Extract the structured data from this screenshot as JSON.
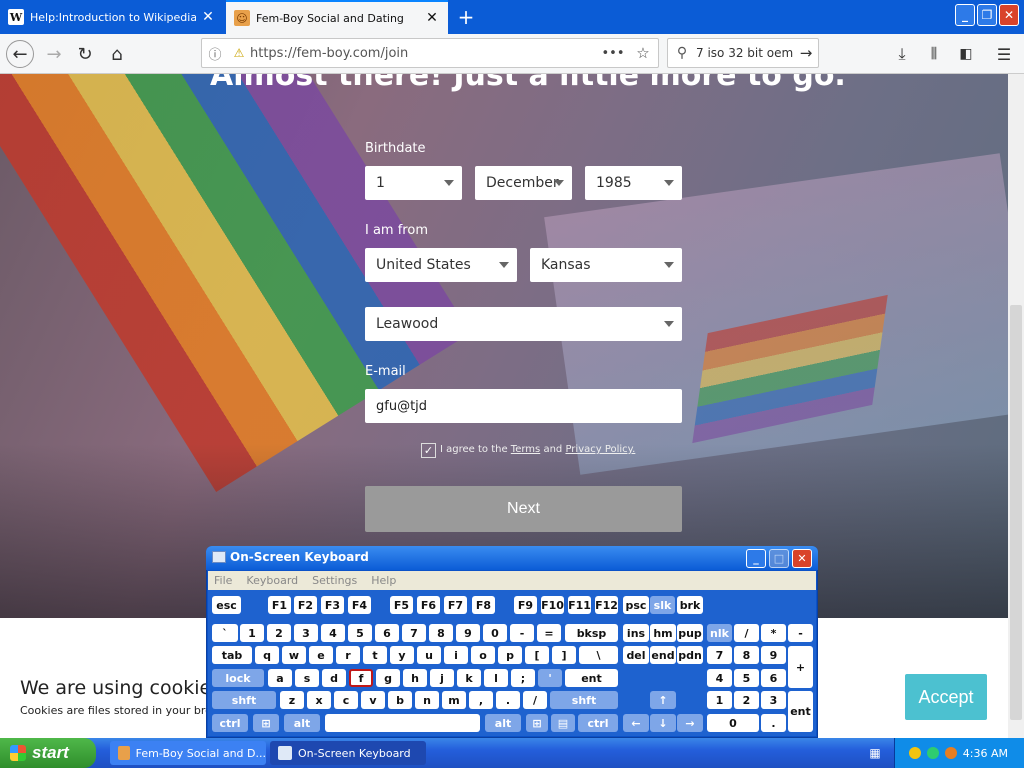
{
  "browser": {
    "tabs": [
      {
        "title": "Help:Introduction to Wikipedia - W",
        "favicon": "W",
        "active": false
      },
      {
        "title": "Fem-Boy Social and Dating",
        "favicon": "fem-boy-logo-icon",
        "active": true
      }
    ],
    "new_tab": "+",
    "url": "https://fem-boy.com/join",
    "search_value": "7 iso 32 bit oem",
    "page_actions": "•••"
  },
  "form": {
    "heading": "Almost there! Just a little more to go.",
    "birthdate_label": "Birthdate",
    "birth_day": "1",
    "birth_month": "December",
    "birth_year": "1985",
    "from_label": "I am from",
    "country": "United States",
    "state": "Kansas",
    "city": "Leawood",
    "email_label": "E-mail",
    "email_value": "gfu@tjd",
    "agree_prefix": "I agree to the",
    "terms_link": "Terms",
    "and_text": "and",
    "privacy_link": "Privacy Policy.",
    "agree_checked": true,
    "next_label": "Next"
  },
  "cookie": {
    "title": "We are using cookies",
    "text": "Cookies are files stored in your bro",
    "accept_label": "Accept"
  },
  "osk": {
    "title": "On-Screen Keyboard",
    "menu": [
      "File",
      "Keyboard",
      "Settings",
      "Help"
    ],
    "highlighted_key": "f"
  },
  "taskbar": {
    "start_label": "start",
    "items": [
      "Fem-Boy Social and D...",
      "On-Screen Keyboard"
    ],
    "time": "4:36 AM"
  },
  "colors": {
    "accent_blue": "#0b5cd6",
    "accept_button": "#4cc1d0",
    "next_button": "#9a9a9a",
    "start_green": "#3a9d35"
  }
}
